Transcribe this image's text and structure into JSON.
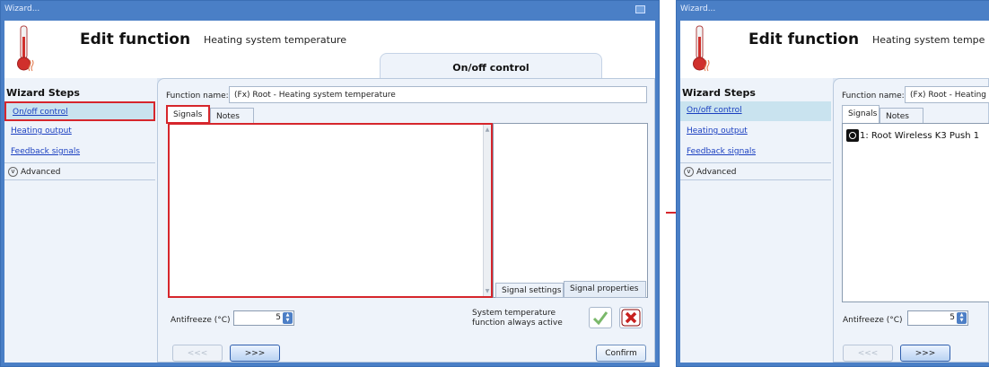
{
  "window_title": "Wizard...",
  "header": {
    "title": "Edit function",
    "subtitle": "Heating system temperature",
    "step_tab": "On/off control"
  },
  "sidebar": {
    "heading": "Wizard Steps",
    "items": [
      {
        "label": "On/off control"
      },
      {
        "label": "Heating output"
      },
      {
        "label": "Feedback signals"
      }
    ],
    "advanced": "Advanced"
  },
  "main": {
    "function_name_label": "Function name:",
    "function_name_value": "(Fx) Root - Heating system temperature",
    "tabs": [
      "Signals",
      "Notes"
    ],
    "panel_tabs": [
      "Signal settings",
      "Signal properties"
    ],
    "antifreeze_label": "Antifreeze (°C)",
    "antifreeze_value": "5",
    "system_temp_label": "System temperature function always active",
    "nav_back": "<<<",
    "nav_next": ">>>",
    "confirm": "Confirm"
  },
  "second_window": {
    "window_title": "Wizard...",
    "subtitle": "Heating system tempe",
    "function_name_value": "(Fx) Root - Heating sy",
    "signal_item": "1: Root Wireless K3 Push 1",
    "antifreeze_label": "Antifreeze (°C)",
    "antifreeze_value": "5"
  },
  "colors": {
    "highlight": "#d6262c",
    "window_frame": "#4a7fc6",
    "link": "#1a3fc0"
  }
}
